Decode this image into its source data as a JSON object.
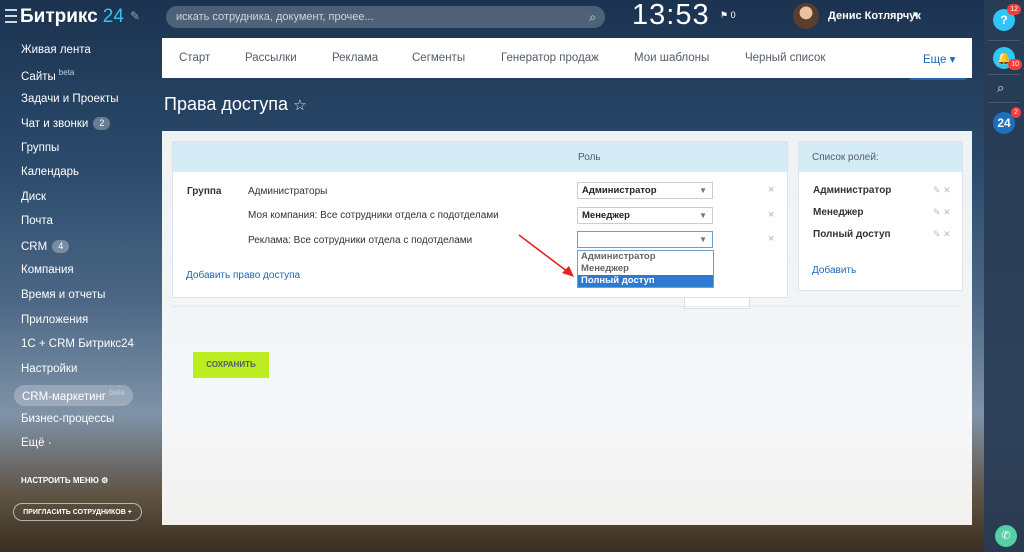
{
  "header": {
    "logo_text": "Битрикс",
    "logo_num": "24",
    "search_placeholder": "искать сотрудника, документ, прочее...",
    "clock": "13:53",
    "flag_count": "0",
    "user_name": "Денис Котлярчук"
  },
  "sidebar": {
    "items": [
      {
        "label": "Живая лента"
      },
      {
        "label": "Сайты",
        "sup": "beta"
      },
      {
        "label": "Задачи и Проекты"
      },
      {
        "label": "Чат и звонки",
        "badge": "2"
      },
      {
        "label": "Группы"
      },
      {
        "label": "Календарь"
      },
      {
        "label": "Диск"
      },
      {
        "label": "Почта"
      },
      {
        "label": "CRM",
        "badge": "4"
      },
      {
        "label": "Компания"
      },
      {
        "label": "Время и отчеты"
      },
      {
        "label": "Приложения"
      },
      {
        "label": "1С + CRM Битрикс24"
      },
      {
        "label": "Настройки"
      },
      {
        "label": "CRM-маркетинг",
        "sup": "beta"
      },
      {
        "label": "Бизнес-процессы"
      },
      {
        "label": "Ещё ·"
      }
    ],
    "configure_label": "НАСТРОИТЬ МЕНЮ",
    "invite_label": "ПРИГЛАСИТЬ СОТРУДНИКОВ"
  },
  "tabs": [
    "Старт",
    "Рассылки",
    "Реклама",
    "Сегменты",
    "Генератор продаж",
    "Мои шаблоны",
    "Черный список",
    "Еще"
  ],
  "page": {
    "title": "Права доступа",
    "table": {
      "role_header": "Роль",
      "group_label": "Группа",
      "rows": [
        {
          "label": "Администраторы",
          "role": "Администратор"
        },
        {
          "label": "Моя компания: Все сотрудники отдела с подотделами",
          "role": "Менеджер"
        },
        {
          "label": "Реклама: Все сотрудники отдела с подотделами",
          "role": ""
        }
      ],
      "dropdown_options": [
        "Администратор",
        "Менеджер",
        "Полный доступ"
      ],
      "dropdown_selected": "Полный доступ",
      "add_link": "Добавить право доступа"
    },
    "save_button": "СОХРАНИТЬ",
    "roles": {
      "header": "Список ролей:",
      "items": [
        "Администратор",
        "Менеджер",
        "Полный доступ"
      ],
      "add_link": "Добавить"
    }
  },
  "rail": {
    "help_badge": "12",
    "notify_badge": "10",
    "b24_badge": "2",
    "b24_label": "24",
    "help_label": "?"
  },
  "colors": {
    "accent": "#2067b0",
    "save": "#bbed21",
    "header_cell": "#d5ebf6",
    "selected_option": "#2b7bd3",
    "badge": "#f03e3e"
  }
}
